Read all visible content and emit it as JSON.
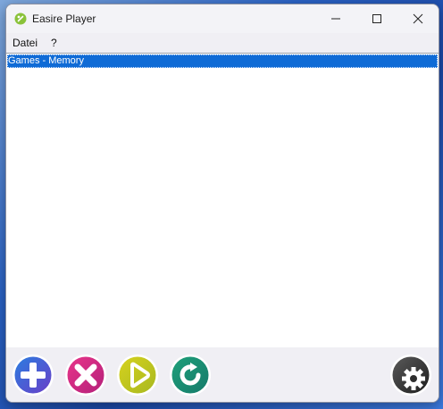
{
  "window": {
    "title": "Easire Player"
  },
  "menu": {
    "items": [
      "Datei",
      "?"
    ]
  },
  "list": {
    "items": [
      "Games - Memory"
    ]
  },
  "colors": {
    "accent": "#0f6bd6",
    "add": "#2f6fd6",
    "remove": "#d8278a",
    "play": "#c3c820",
    "refresh": "#1a8f74",
    "settings": "#3a3a3a"
  },
  "toolbar": {
    "icons": [
      "add-icon",
      "remove-icon",
      "play-icon",
      "refresh-icon",
      "settings-icon"
    ]
  }
}
